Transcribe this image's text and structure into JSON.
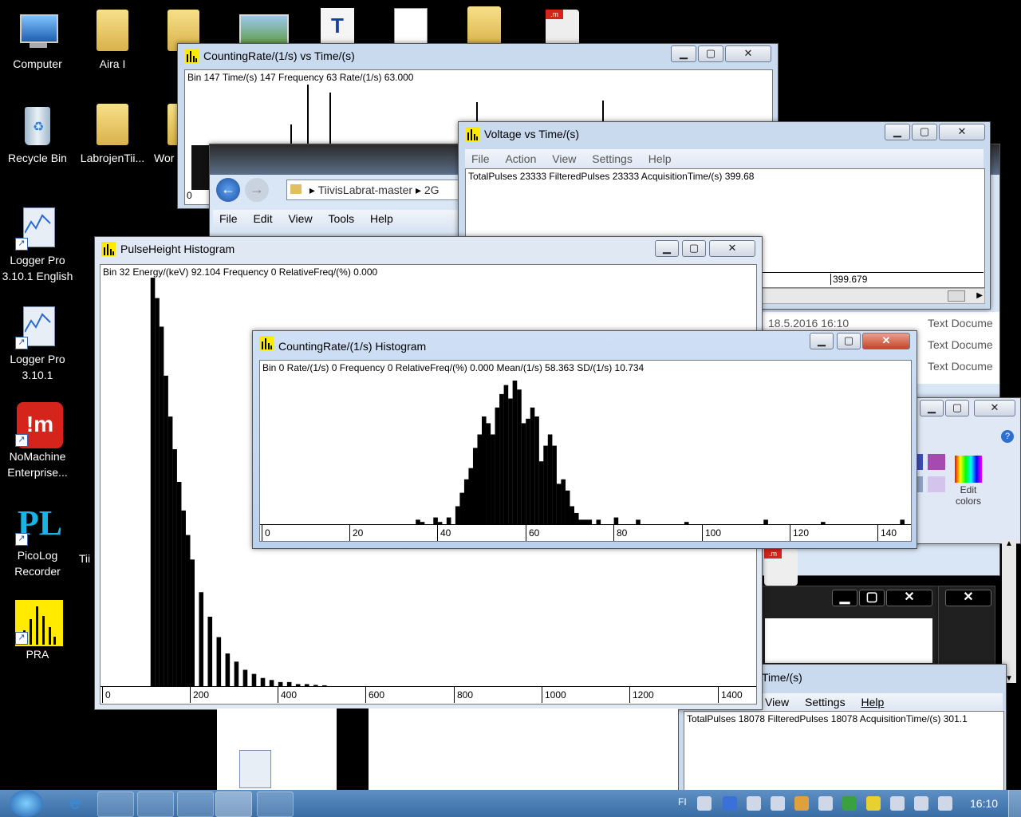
{
  "desktop_icons": [
    {
      "label": "Computer"
    },
    {
      "label": "Aira I"
    },
    {
      "label": "Recycle Bin"
    },
    {
      "label": "LabrojenTii..."
    },
    {
      "label": "Logger Pro 3.10.1 English"
    },
    {
      "label": "Logger Pro 3.10.1"
    },
    {
      "label": "NoMachine Enterprise..."
    },
    {
      "label": "PicoLog Recorder"
    },
    {
      "label": "PRA"
    }
  ],
  "partial_icon_labels": [
    "T",
    "Wor",
    "Tii"
  ],
  "win_rate_time": {
    "title": "CountingRate/(1/s) vs Time/(s)",
    "info": "Bin 147  Time/(s) 147  Frequency 63  Rate/(1/s) 63.000",
    "axis_first": "0"
  },
  "win_voltage": {
    "title": "Voltage vs Time/(s)",
    "menu": [
      "File",
      "Action",
      "View",
      "Settings",
      "Help"
    ],
    "info": "TotalPulses 23333  FilteredPulses 23333  AcquisitionTime/(s) 399.68",
    "axis_label": "399.679"
  },
  "win_explorer": {
    "breadcrumb": [
      "TiivisLabrat-master",
      "2G"
    ],
    "menu": [
      "File",
      "Edit",
      "View",
      "Tools",
      "Help"
    ],
    "files": [
      {
        "date": "18.5.2016 16:10",
        "type": "Text Docume"
      },
      {
        "type": "Text Docume"
      },
      {
        "type": "Text Docume"
      }
    ]
  },
  "win_pulseheight": {
    "title": "PulseHeight Histogram",
    "info": "Bin 32  Energy/(keV) 92.104  Frequency 0  RelativeFreq/(%) 0.000",
    "ticks": [
      "0",
      "200",
      "400",
      "600",
      "800",
      "1000",
      "1200",
      "1400"
    ]
  },
  "win_countrate_hist": {
    "title": "CountingRate/(1/s) Histogram",
    "info": "Bin 0  Rate/(1/s) 0  Frequency 0  RelativeFreq/(%) 0.000  Mean/(1/s) 58.363  SD/(1/s) 10.734",
    "ticks": [
      "0",
      "20",
      "40",
      "60",
      "80",
      "100",
      "120",
      "140"
    ]
  },
  "win_paint": {
    "edit_colors": "Edit colors"
  },
  "win_bottom": {
    "title_partial": "Time/(s)",
    "menu": [
      "View",
      "Settings",
      "Help"
    ],
    "info": "TotalPulses 18078  FilteredPulses 18078  AcquisitionTime/(s) 301.1"
  },
  "taskbar": {
    "lang": "FI",
    "clock": "16:10"
  },
  "chart_data": [
    {
      "type": "bar",
      "title": "CountingRate/(1/s) Histogram",
      "xlabel": "Rate/(1/s)",
      "ylabel": "Frequency",
      "xlim": [
        0,
        145
      ],
      "x": [
        35,
        36,
        39,
        40,
        42,
        44,
        45,
        46,
        47,
        48,
        49,
        50,
        51,
        52,
        53,
        54,
        55,
        56,
        57,
        58,
        59,
        60,
        61,
        62,
        63,
        64,
        65,
        66,
        67,
        68,
        69,
        70,
        71,
        72,
        73,
        74,
        76,
        80,
        85,
        96,
        114,
        127,
        145
      ],
      "values": [
        2,
        1,
        3,
        1,
        3,
        8,
        14,
        20,
        25,
        34,
        40,
        48,
        45,
        40,
        52,
        58,
        62,
        56,
        64,
        60,
        45,
        47,
        52,
        48,
        28,
        35,
        40,
        35,
        18,
        20,
        15,
        8,
        5,
        2,
        2,
        2,
        2,
        3,
        2,
        1,
        2,
        1,
        2
      ]
    },
    {
      "type": "bar",
      "title": "PulseHeight Histogram",
      "xlabel": "Energy/(keV)",
      "ylabel": "Frequency",
      "xlim": [
        0,
        1450
      ],
      "x": [
        110,
        120,
        130,
        140,
        150,
        160,
        170,
        180,
        190,
        200,
        220,
        240,
        260,
        280,
        300,
        320,
        340,
        360,
        380,
        400,
        420,
        440,
        460,
        480,
        500
      ],
      "values": [
        100,
        95,
        88,
        76,
        66,
        58,
        50,
        43,
        37,
        31,
        23,
        17,
        12,
        8,
        6,
        4,
        3,
        2,
        1.5,
        1,
        1,
        0.5,
        0.5,
        0.3,
        0.2
      ]
    }
  ]
}
